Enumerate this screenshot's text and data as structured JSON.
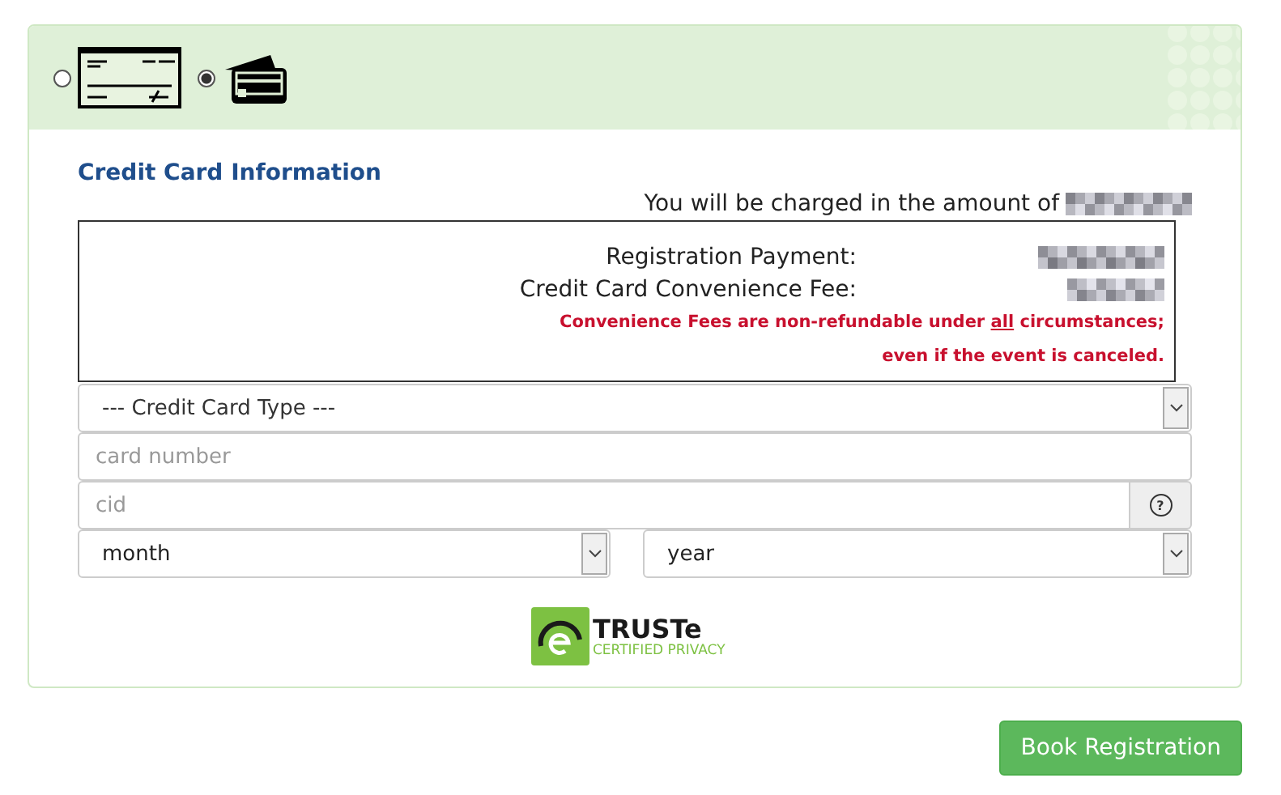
{
  "payment_methods": [
    {
      "kind": "check",
      "selected": false
    },
    {
      "kind": "card",
      "selected": true
    }
  ],
  "section_title": "Credit Card Information",
  "charge_line": "You will be charged in the amount of",
  "summary": {
    "rows": [
      {
        "label": "Registration Payment:"
      },
      {
        "label": "Credit Card Convenience Fee:"
      }
    ],
    "note_lines": [
      [
        {
          "text": "Convenience Fees are non-refundable under ",
          "underline": false
        },
        {
          "text": "all",
          "underline": true
        },
        {
          "text": " circumstances;",
          "underline": false
        }
      ],
      [
        {
          "text": "even if the event is canceled.",
          "underline": false
        }
      ]
    ]
  },
  "card_type": {
    "value": "--- Credit Card Type ---"
  },
  "card_number": {
    "placeholder": "card number"
  },
  "cid": {
    "placeholder": "cid",
    "help_icon": "?"
  },
  "month": {
    "value": "month"
  },
  "year": {
    "value": "year"
  },
  "seal": {
    "brand": "TRUSTe",
    "caption": "CERTIFIED PRIVACY"
  },
  "submit_button": "Book Registration"
}
